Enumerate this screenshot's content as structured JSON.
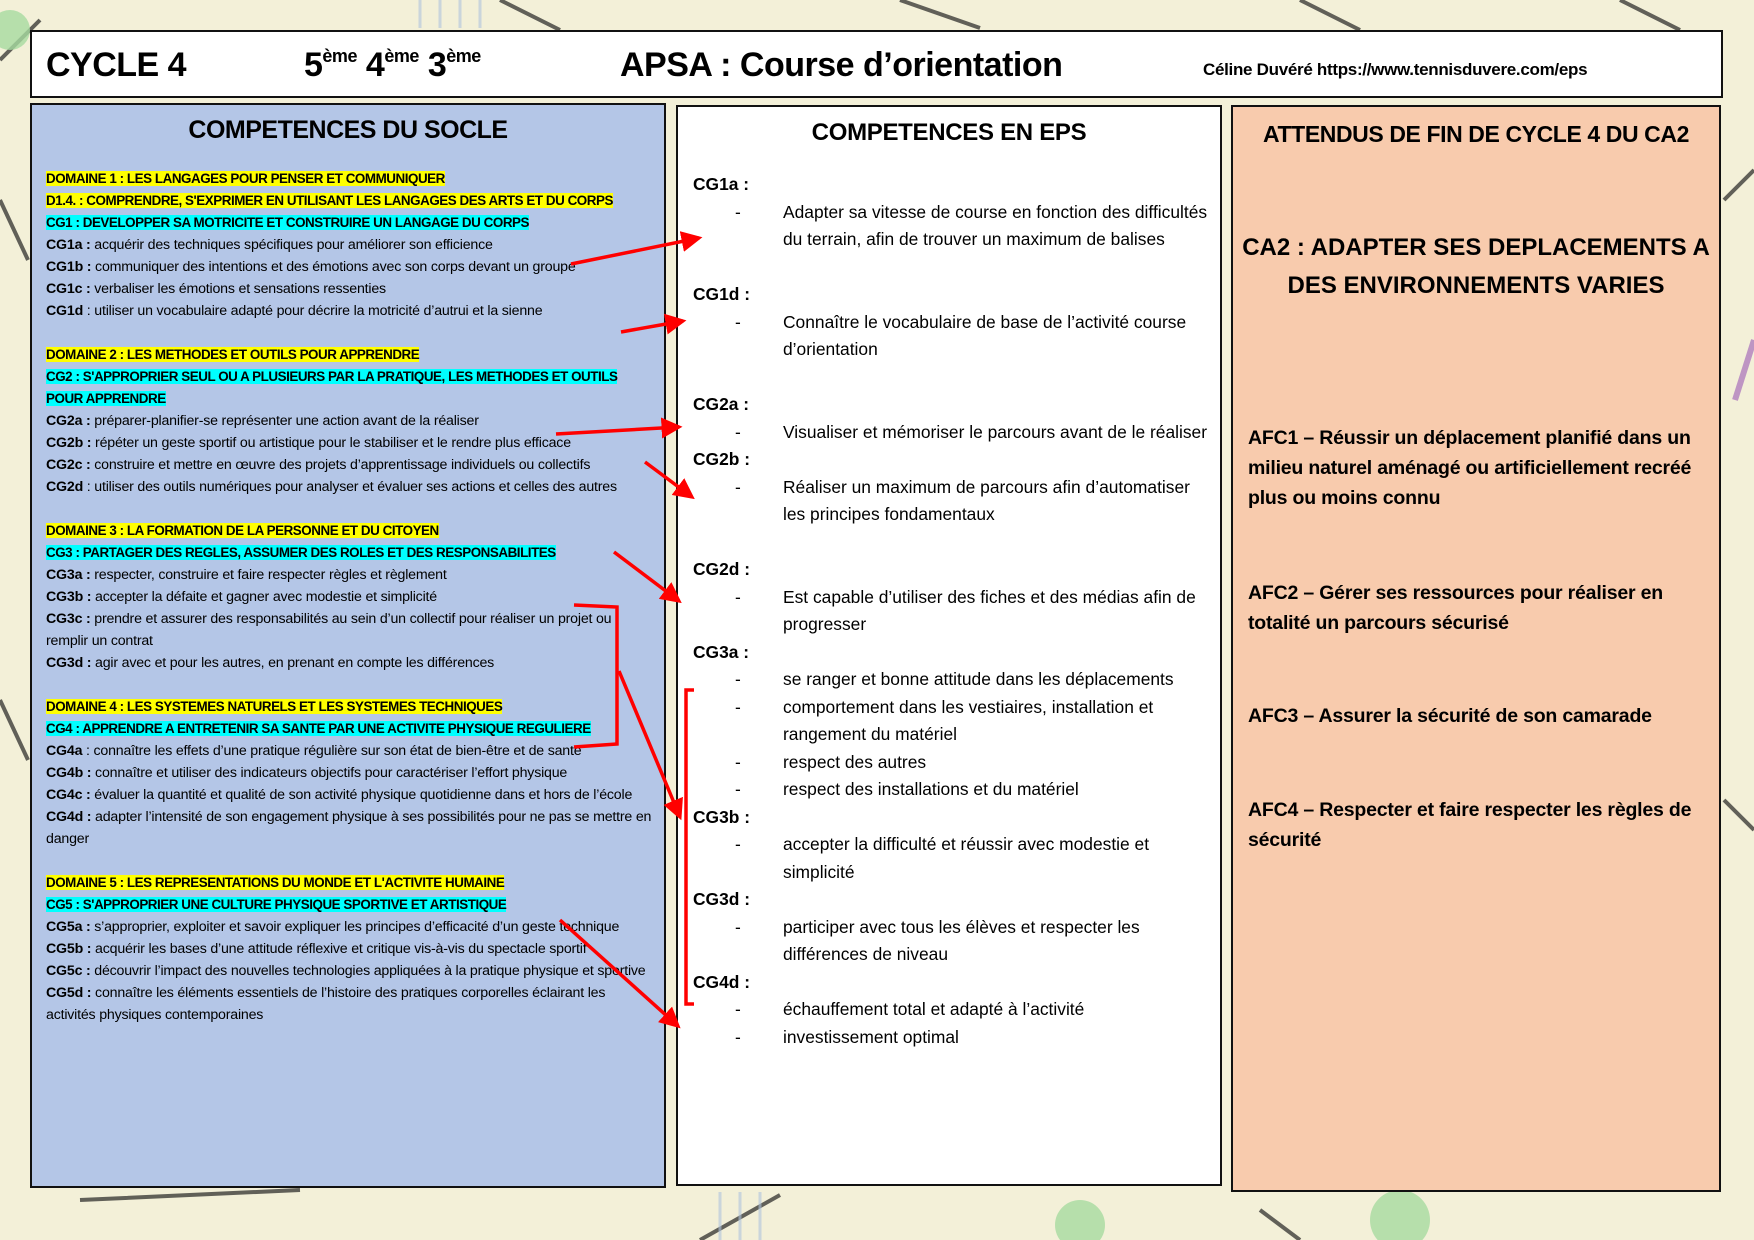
{
  "header": {
    "cycle": "CYCLE 4",
    "levels": [
      {
        "num": "5",
        "sup": "ème"
      },
      {
        "num": "4",
        "sup": "ème"
      },
      {
        "num": "3",
        "sup": "ème"
      }
    ],
    "apsa": "APSA : Course d’orientation",
    "author": "Céline Duvéré https://www.tennisduvere.com/eps"
  },
  "socle": {
    "title": "COMPETENCES DU SOCLE",
    "domains": [
      {
        "domain": "DOMAINE 1 : LES LANGAGES POUR PENSER ET COMMUNIQUER",
        "sub": "D1.4. : COMPRENDRE, S'EXPRIMER EN UTILISANT LES LANGAGES DES ARTS ET DU CORPS",
        "cg": "CG1 : DEVELOPPER SA MOTRICITE ET CONSTRUIRE UN LANGAGE DU CORPS",
        "items": [
          {
            "code": "CG1a :",
            "text": " acquérir des techniques spécifiques pour améliorer son efficience"
          },
          {
            "code": "CG1b :",
            "text": " communiquer des intentions et des émotions avec son corps devant un groupe"
          },
          {
            "code": "CG1c :",
            "text": " verbaliser les émotions et sensations ressenties"
          },
          {
            "code": "CG1d",
            "text": " : utiliser un vocabulaire adapté pour décrire la motricité d’autrui et la sienne"
          }
        ]
      },
      {
        "domain": "DOMAINE 2 : LES METHODES ET OUTILS POUR APPRENDRE",
        "cg": "CG2 : S'APPROPRIER SEUL OU A PLUSIEURS PAR LA PRATIQUE, LES METHODES ET OUTILS POUR APPRENDRE",
        "items": [
          {
            "code": "CG2a :",
            "text": " préparer-planifier-se représenter une action avant de la réaliser"
          },
          {
            "code": "CG2b :",
            "text": " répéter un geste sportif ou artistique pour le stabiliser et le rendre plus efficace"
          },
          {
            "code": "CG2c :",
            "text": " construire et mettre en œuvre des projets d’apprentissage individuels ou collectifs"
          },
          {
            "code": "CG2d",
            "text": " : utiliser des outils numériques pour analyser et évaluer ses actions et celles des autres"
          }
        ]
      },
      {
        "domain": "DOMAINE 3 : LA FORMATION DE LA PERSONNE ET DU CITOYEN",
        "cg": "CG3 : PARTAGER DES REGLES, ASSUMER DES ROLES ET DES RESPONSABILITES",
        "items": [
          {
            "code": "CG3a :",
            "text": " respecter, construire et faire respecter règles et règlement"
          },
          {
            "code": "CG3b :",
            "text": " accepter la défaite et gagner avec modestie et simplicité"
          },
          {
            "code": "CG3c :",
            "text": " prendre et assurer des responsabilités au sein d’un collectif pour réaliser un projet ou remplir un contrat"
          },
          {
            "code": "CG3d :",
            "text": " agir avec et pour les autres, en prenant en compte les différences"
          }
        ]
      },
      {
        "domain": "DOMAINE 4 : LES SYSTEMES NATURELS ET LES SYSTEMES TECHNIQUES",
        "cg": "CG4 : APPRENDRE A ENTRETENIR SA SANTE PAR UNE ACTIVITE PHYSIQUE REGULIERE",
        "items": [
          {
            "code": "CG4a",
            "text": " : connaître les effets d’une pratique régulière sur son état de bien-être et de santé"
          },
          {
            "code": "CG4b :",
            "text": " connaître et utiliser des indicateurs objectifs pour caractériser l’effort physique"
          },
          {
            "code": "CG4c :",
            "text": " évaluer la quantité et qualité de son activité physique quotidienne dans et hors de l’école"
          },
          {
            "code": "CG4d :",
            "text": " adapter l’intensité de son engagement physique à ses possibilités pour ne pas se mettre en danger"
          }
        ]
      },
      {
        "domain": "DOMAINE 5 : LES REPRESENTATIONS DU MONDE ET L'ACTIVITE HUMAINE",
        "cg": "CG5 : S'APPROPRIER UNE CULTURE PHYSIQUE SPORTIVE ET ARTISTIQUE",
        "items": [
          {
            "code": "CG5a :",
            "text": " s’approprier, exploiter et savoir expliquer les principes d’efficacité d’un geste technique"
          },
          {
            "code": "CG5b :",
            "text": " acquérir les bases d’une attitude réflexive et critique vis-à-vis du spectacle sportif"
          },
          {
            "code": "CG5c :",
            "text": " découvrir l’impact des nouvelles technologies appliquées à la pratique physique et sportive"
          },
          {
            "code": "CG5d :",
            "text": " connaître les éléments essentiels de l’histoire des pratiques corporelles éclairant les activités physiques contemporaines"
          }
        ]
      }
    ]
  },
  "eps": {
    "title": "COMPETENCES EN EPS",
    "dash": "-",
    "groups": [
      {
        "label": "CG1a :",
        "items": [
          "Adapter sa vitesse de course en fonction des difficultés du terrain, afin de trouver un maximum de balises"
        ]
      },
      {
        "label": "CG1d :",
        "items": [
          "Connaître le vocabulaire de base de l’activité course d’orientation"
        ]
      },
      {
        "label": "CG2a :",
        "items": [
          "Visualiser et mémoriser le parcours avant de le réaliser"
        ]
      },
      {
        "label": "CG2b :",
        "items": [
          "Réaliser un maximum de parcours afin d’automatiser les principes fondamentaux"
        ]
      },
      {
        "label": "CG2d :",
        "items": [
          "Est capable d’utiliser des fiches et des médias afin de progresser"
        ]
      },
      {
        "label": "CG3a :",
        "items": [
          "se ranger et bonne attitude dans les déplacements",
          "comportement dans les vestiaires, installation et rangement du matériel",
          "respect des autres",
          "respect des installations et du matériel"
        ]
      },
      {
        "label": "CG3b :",
        "items": [
          "accepter la difficulté et réussir avec modestie et simplicité"
        ]
      },
      {
        "label": "CG3d :",
        "items": [
          "participer avec tous les élèves et respecter les différences de niveau"
        ]
      },
      {
        "label": "CG4d :",
        "items": [
          "échauffement total et adapté à l’activité",
          "investissement optimal"
        ]
      }
    ]
  },
  "attendus": {
    "title": "ATTENDUS DE FIN DE CYCLE 4 DU CA2",
    "ca2": "CA2 : ADAPTER SES DEPLACEMENTS A DES ENVIRONNEMENTS VARIES",
    "afc": [
      "AFC1 – Réussir un déplacement planifié dans un milieu naturel aménagé ou artificiellement recréé plus ou moins connu",
      "AFC2 – Gérer ses ressources pour réaliser en totalité un parcours sécurisé",
      "AFC3 – Assurer la sécurité de son camarade",
      "AFC4 – Respecter et faire respecter les règles de sécurité"
    ]
  },
  "colors": {
    "socle_bg": "#b4c6e7",
    "attendus_bg": "#f8cbad",
    "domain_highlight": "#ffff00",
    "cg_highlight": "#00ffff",
    "arrow": "#ff0000"
  }
}
